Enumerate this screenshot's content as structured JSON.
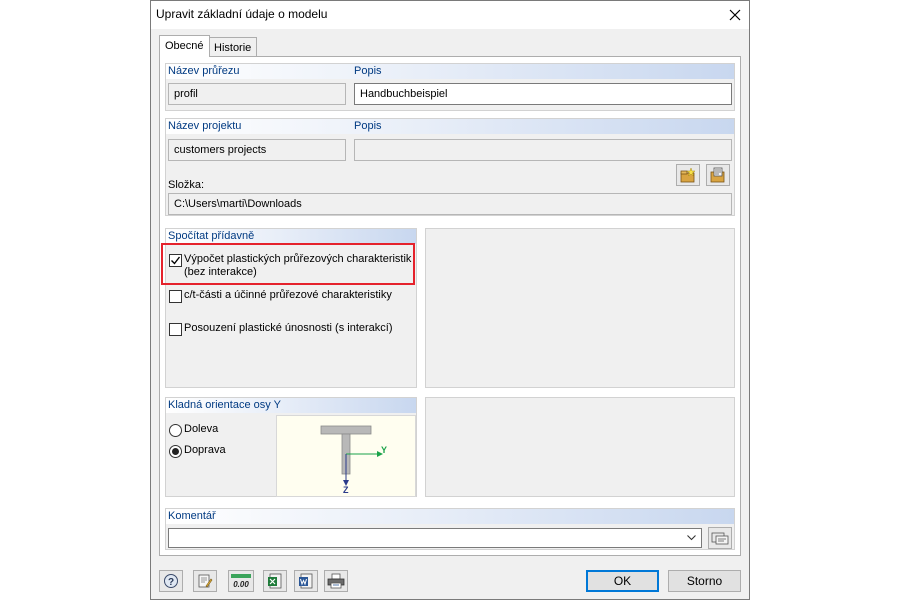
{
  "dialog": {
    "title": "Upravit základní údaje o modelu",
    "tabs": [
      {
        "label": "Obecné"
      },
      {
        "label": "Historie"
      }
    ]
  },
  "cross_section": {
    "name_label": "Název průřezu",
    "name_value": "profil",
    "desc_label": "Popis",
    "desc_value": "Handbuchbeispiel"
  },
  "project": {
    "name_label": "Název projektu",
    "name_value": "customers projects",
    "desc_label": "Popis",
    "desc_value": "",
    "folder_label": "Složka:",
    "folder_value": "C:\\Users\\marti\\Downloads"
  },
  "calc": {
    "header": "Spočítat přídavně",
    "options": [
      {
        "label": "Výpočet plastických průřezových charakteristik (bez interakce)",
        "checked": true
      },
      {
        "label": "c/t-části a účinné průřezové charakteristiky",
        "checked": false
      },
      {
        "label": "Posouzení plastické únosnosti (s interakcí)",
        "checked": false
      }
    ]
  },
  "orientation": {
    "header": "Kladná orientace osy Y",
    "options": [
      {
        "label": "Doleva",
        "selected": false
      },
      {
        "label": "Doprava",
        "selected": true
      }
    ],
    "axis_y": "Y",
    "axis_z": "Z"
  },
  "comment": {
    "header": "Komentář",
    "value": ""
  },
  "buttons": {
    "ok": "OK",
    "cancel": "Storno",
    "units_text": "0.00"
  },
  "colors": {
    "group_header_text": "#003a82",
    "highlight_border": "#e5222c",
    "default_button_border": "#0078d7"
  }
}
